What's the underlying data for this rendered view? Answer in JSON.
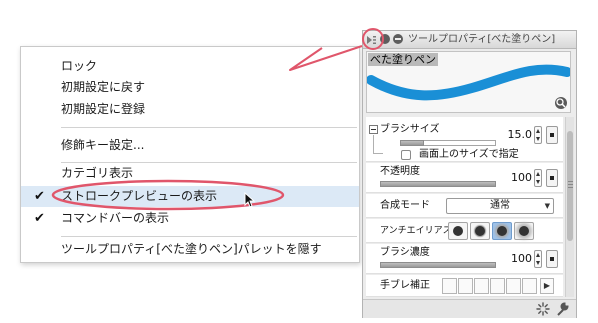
{
  "menu": {
    "items": [
      {
        "label": "ロック",
        "checked": false,
        "highlighted": false
      },
      {
        "label": "初期設定に戻す",
        "checked": false,
        "highlighted": false
      },
      {
        "label": "初期設定に登録",
        "checked": false,
        "highlighted": false
      },
      {
        "label": "修飾キー設定...",
        "checked": false,
        "highlighted": false
      },
      {
        "label": "カテゴリ表示",
        "checked": false,
        "highlighted": false
      },
      {
        "label": "ストロークプレビューの表示",
        "checked": true,
        "highlighted": true
      },
      {
        "label": "コマンドバーの表示",
        "checked": true,
        "highlighted": false
      },
      {
        "label": "ツールプロパティ[べた塗りペン]パレットを隠す",
        "checked": false,
        "highlighted": false
      }
    ],
    "check_glyph": "✔"
  },
  "panel": {
    "title": "ツールプロパティ[べた塗りペン]",
    "preview_label": "べた塗りペン",
    "stroke_color": "#1a8fd6",
    "brush_size": {
      "label": "ブラシサイズ",
      "value": "15.0",
      "level": 0.25
    },
    "screen_size_checkbox": {
      "label": "画面上のサイズで指定",
      "checked": false
    },
    "opacity": {
      "label": "不透明度",
      "value": "100",
      "level": 1.0
    },
    "blend_mode": {
      "label": "合成モード",
      "value": "通常"
    },
    "antialias": {
      "label": "アンチエイリアス",
      "options": [
        "none",
        "weak",
        "medium",
        "strong"
      ],
      "selected": 2
    },
    "brush_density": {
      "label": "ブラシ濃度",
      "value": "100",
      "level": 1.0
    },
    "stabilization": {
      "label": "手ブレ補正"
    }
  },
  "colors": {
    "annotation": "#e0566b",
    "menu_highlight": "#dce9f6"
  }
}
